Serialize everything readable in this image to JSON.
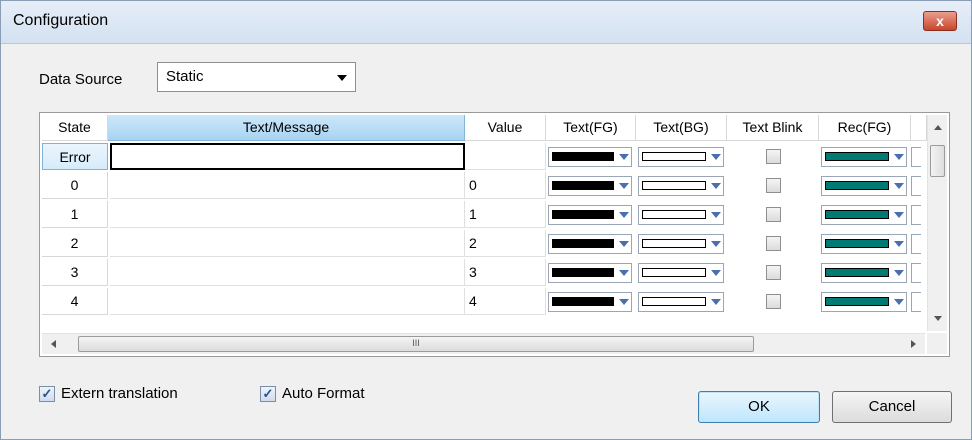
{
  "window": {
    "title": "Configuration",
    "close_icon": "close-icon",
    "close_label": "x"
  },
  "data_source": {
    "label": "Data Source",
    "value": "Static"
  },
  "grid": {
    "columns": [
      "State",
      "Text/Message",
      "Value",
      "Text(FG)",
      "Text(BG)",
      "Text Blink",
      "Rec(FG)"
    ],
    "rows": [
      {
        "state": "Error",
        "message": "",
        "value": ""
      },
      {
        "state": "0",
        "message": "",
        "value": "0"
      },
      {
        "state": "1",
        "message": "",
        "value": "1"
      },
      {
        "state": "2",
        "message": "",
        "value": "2"
      },
      {
        "state": "3",
        "message": "",
        "value": "3"
      },
      {
        "state": "4",
        "message": "",
        "value": "4"
      }
    ],
    "colors": {
      "text_fg": "#000000",
      "text_bg": "#ffffff",
      "rec_fg": "#007b73"
    },
    "hscroll_grip": "III"
  },
  "options": {
    "extern_translation": {
      "label": "Extern translation",
      "checked": true,
      "mark": "✓"
    },
    "auto_format": {
      "label": "Auto Format",
      "checked": true,
      "mark": "✓"
    }
  },
  "buttons": {
    "ok": "OK",
    "cancel": "Cancel"
  }
}
